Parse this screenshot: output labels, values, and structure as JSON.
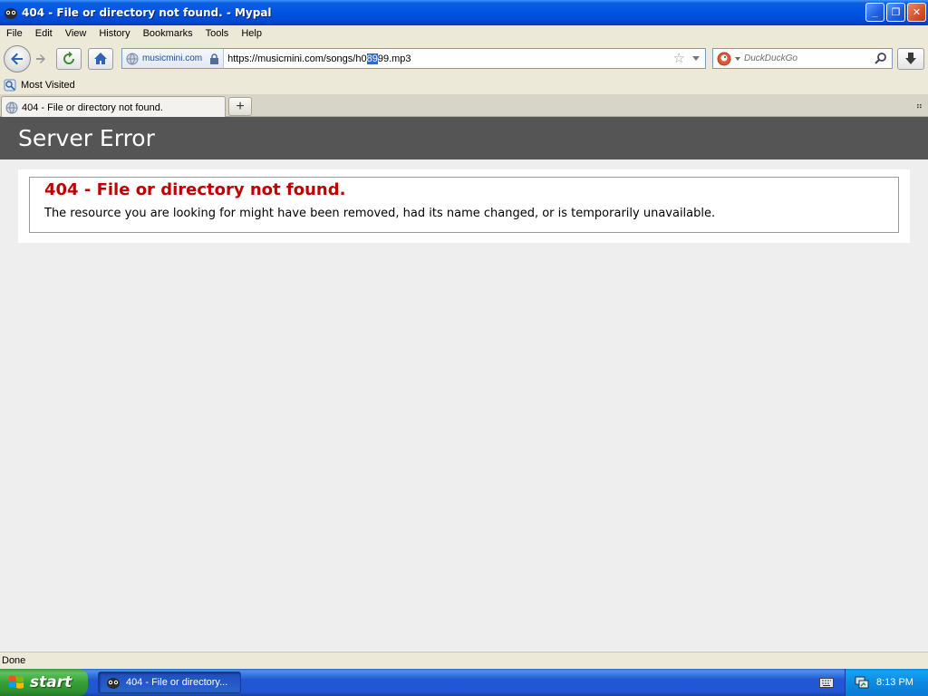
{
  "window": {
    "title": "404 - File or directory not found. - Mypal",
    "minimize_glyph": "_",
    "maximize_glyph": "❐",
    "close_glyph": "✕"
  },
  "menu": [
    "File",
    "Edit",
    "View",
    "History",
    "Bookmarks",
    "Tools",
    "Help"
  ],
  "navigation": {
    "identity_label": "musicmini.com",
    "url_before_selection": "https://musicmini.com/songs/h0",
    "url_selection": "89",
    "url_after_selection": "99.mp3",
    "search_placeholder": "DuckDuckGo"
  },
  "bookmarks": [
    {
      "label": "Most Visited"
    }
  ],
  "tabs": [
    {
      "label": "404 - File or directory not found."
    }
  ],
  "new_tab_glyph": "+",
  "tab_list_glyph": "⠶",
  "page": {
    "header": "Server Error",
    "error_title": "404 - File or directory not found.",
    "error_message": "The resource you are looking for might have been removed, had its name changed, or is temporarily unavailable."
  },
  "status": "Done",
  "taskbar": {
    "start_label": "start",
    "task_label": "404 - File or directory...",
    "clock": "8:13 PM"
  },
  "colors": {
    "title_bar": "#0054e3",
    "server_header_bg": "#555555",
    "error_title": "#c00000",
    "start_button": "#36a036"
  }
}
